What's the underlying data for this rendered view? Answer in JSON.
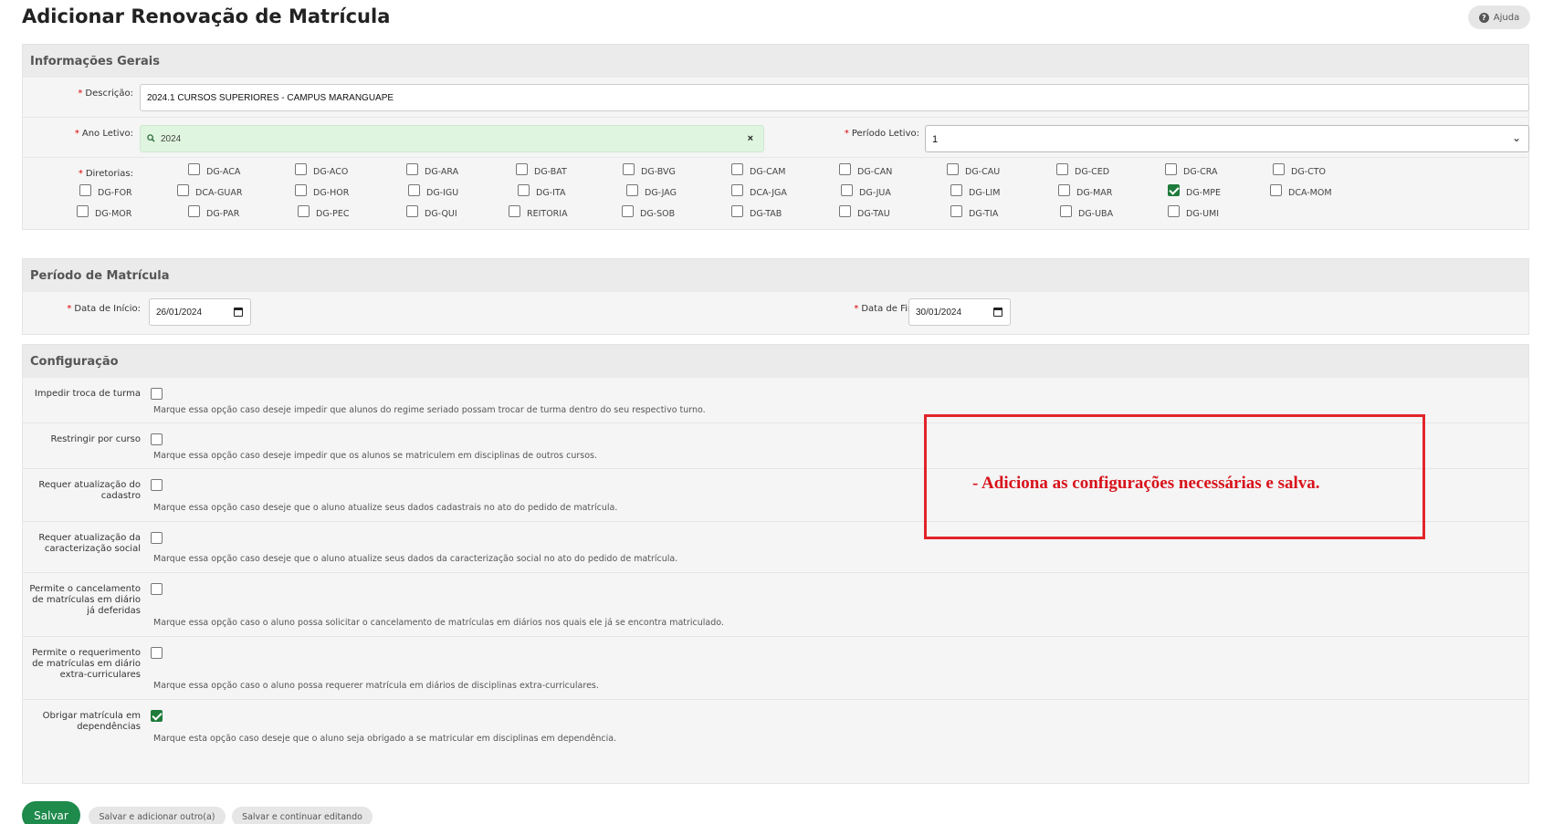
{
  "page": {
    "title": "Adicionar Renovação de Matrícula",
    "help_label": "Ajuda",
    "help_icon": "question-circle-icon"
  },
  "general": {
    "legend": "Informações Gerais",
    "descricao_label": "Descrição:",
    "descricao_value": "2024.1 CURSOS SUPERIORES - CAMPUS MARANGUAPE",
    "ano_label": "Ano Letivo:",
    "ano_value": "2024",
    "ano_clear": "×",
    "periodo_label": "Período Letivo:",
    "periodo_value": "1",
    "diretorias_label": "Diretorias:",
    "diretorias": [
      {
        "label": "DG-ACA",
        "checked": false
      },
      {
        "label": "DG-ACO",
        "checked": false
      },
      {
        "label": "DG-ARA",
        "checked": false
      },
      {
        "label": "DG-BAT",
        "checked": false
      },
      {
        "label": "DG-BVG",
        "checked": false
      },
      {
        "label": "DG-CAM",
        "checked": false
      },
      {
        "label": "DG-CAN",
        "checked": false
      },
      {
        "label": "DG-CAU",
        "checked": false
      },
      {
        "label": "DG-CED",
        "checked": false
      },
      {
        "label": "DG-CRA",
        "checked": false
      },
      {
        "label": "DG-CTO",
        "checked": false
      },
      {
        "label": "DG-FOR",
        "checked": false
      },
      {
        "label": "DCA-GUAR",
        "checked": false
      },
      {
        "label": "DG-HOR",
        "checked": false
      },
      {
        "label": "DG-IGU",
        "checked": false
      },
      {
        "label": "DG-ITA",
        "checked": false
      },
      {
        "label": "DG-JAG",
        "checked": false
      },
      {
        "label": "DCA-JGA",
        "checked": false
      },
      {
        "label": "DG-JUA",
        "checked": false
      },
      {
        "label": "DG-LIM",
        "checked": false
      },
      {
        "label": "DG-MAR",
        "checked": false
      },
      {
        "label": "DG-MPE",
        "checked": true
      },
      {
        "label": "DCA-MOM",
        "checked": false
      },
      {
        "label": "DG-MOR",
        "checked": false
      },
      {
        "label": "DG-PAR",
        "checked": false
      },
      {
        "label": "DG-PEC",
        "checked": false
      },
      {
        "label": "DG-QUI",
        "checked": false
      },
      {
        "label": "REITORIA",
        "checked": false
      },
      {
        "label": "DG-SOB",
        "checked": false
      },
      {
        "label": "DG-TAB",
        "checked": false
      },
      {
        "label": "DG-TAU",
        "checked": false
      },
      {
        "label": "DG-TIA",
        "checked": false
      },
      {
        "label": "DG-UBA",
        "checked": false
      },
      {
        "label": "DG-UMI",
        "checked": false
      }
    ]
  },
  "periodo": {
    "legend": "Período de Matrícula",
    "inicio_label": "Data de Início:",
    "inicio_value": "26/01/2024",
    "fim_label": "Data de Fim:",
    "fim_value": "30/01/2024"
  },
  "config": {
    "legend": "Configuração",
    "items": [
      {
        "label": "Impedir troca de turma",
        "help": "Marque essa opção caso deseje impedir que alunos do regime seriado possam trocar de turma dentro do seu respectivo turno.",
        "checked": false
      },
      {
        "label": "Restringir por curso",
        "help": "Marque essa opção caso deseje impedir que os alunos se matriculem em disciplinas de outros cursos.",
        "checked": false
      },
      {
        "label": "Requer atualização do cadastro",
        "help": "Marque essa opção caso deseje que o aluno atualize seus dados cadastrais no ato do pedido de matrícula.",
        "checked": false
      },
      {
        "label": "Requer atualização da caracterização social",
        "help": "Marque essa opção caso deseje que o aluno atualize seus dados da caracterização social no ato do pedido de matrícula.",
        "checked": false
      },
      {
        "label": "Permite o cancelamento de matrículas em diário já deferidas",
        "help": "Marque essa opção caso o aluno possa solicitar o cancelamento de matrículas em diários nos quais ele já se encontra matriculado.",
        "checked": false
      },
      {
        "label": "Permite o requerimento de matrículas em diário extra-curriculares",
        "help": "Marque essa opção caso o aluno possa requerer matrícula em diários de disciplinas extra-curriculares.",
        "checked": false
      },
      {
        "label": "Obrigar matrícula em dependências",
        "help": "Marque esta opção caso deseje que o aluno seja obrigado a se matricular em disciplinas em dependência.",
        "checked": true
      }
    ]
  },
  "annotation": {
    "text": "- Adiciona as configurações necessárias e salva.",
    "color": "#e2242b"
  },
  "actions": {
    "save": "Salvar",
    "save_add": "Salvar e adicionar outro(a)",
    "save_continue": "Salvar e continuar editando",
    "primary_color": "#1e8a4c"
  }
}
